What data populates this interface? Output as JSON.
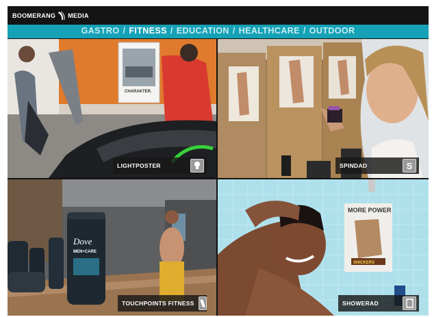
{
  "brand": {
    "name": "BOOMERANG",
    "name2": "MEDIA"
  },
  "nav": {
    "items": [
      {
        "label": "GASTRO",
        "active": false
      },
      {
        "label": "FITNESS",
        "active": true
      },
      {
        "label": "EDUCATION",
        "active": false
      },
      {
        "label": "HEALTHCARE",
        "active": false
      },
      {
        "label": "OUTDOOR",
        "active": false
      }
    ],
    "separator": "/"
  },
  "tiles": [
    {
      "label": "LIGHTPOSTER",
      "icon": "lightbulb-icon"
    },
    {
      "label": "SPINDAD",
      "icon": "s-letter-icon",
      "icon_char": "S"
    },
    {
      "label": "TOUCHPOINTS FITNESS",
      "icon": "bottle-icon"
    },
    {
      "label": "SHOWERAD",
      "icon": "poster-icon"
    }
  ],
  "scene_text": {
    "poster_charakter": "CHARAKTER.",
    "dove_brand": "Dove",
    "dove_line": "MEN+CARE",
    "more_power": "MORE POWER",
    "snickers": "SNICKERS"
  },
  "colors": {
    "nav_bg": "#15a1b6",
    "topbar_bg": "#141414",
    "active_nav": "#ffffff",
    "inactive_nav": "#c9eef3"
  }
}
